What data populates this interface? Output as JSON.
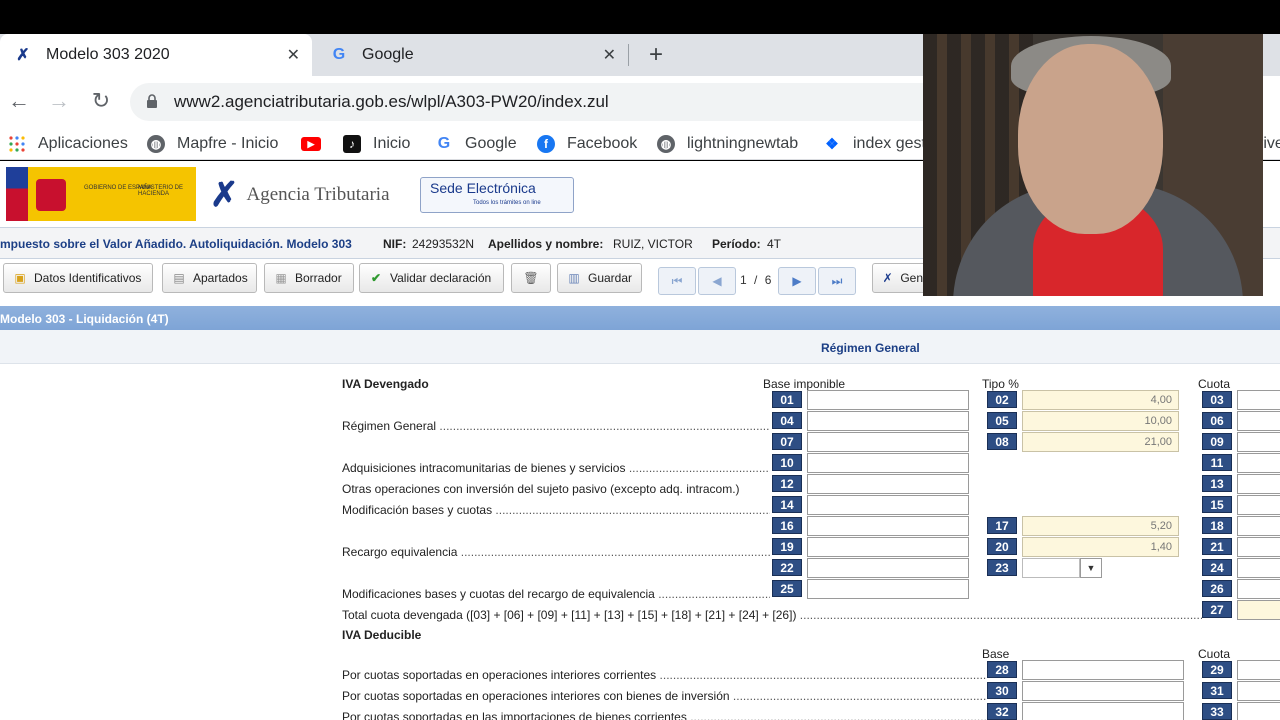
{
  "browser": {
    "tabs": [
      {
        "title": "Modelo 303 2020",
        "favicon": "agencia-tributaria-logo",
        "close": "✕"
      },
      {
        "title": "Google",
        "favicon": "google-logo",
        "close": "✕"
      }
    ],
    "new_tab": "+",
    "url": "www2.agenciatributaria.gob.es/wlpl/A303-PW20/index.zul",
    "bookmarks": [
      {
        "label": "Aplicaciones",
        "icon": "apps-grid-icon"
      },
      {
        "label": "Mapfre - Inicio",
        "icon": "globe-icon"
      },
      {
        "label": "",
        "icon": "youtube-icon"
      },
      {
        "label": "Inicio",
        "icon": "tiktok-like-icon"
      },
      {
        "label": "Google",
        "icon": "google-icon"
      },
      {
        "label": "Facebook",
        "icon": "facebook-icon"
      },
      {
        "label": "lightningnewtab",
        "icon": "globe-icon"
      },
      {
        "label": "index gest",
        "icon": "dropbox-icon"
      },
      {
        "label": "rive",
        "icon": ""
      }
    ]
  },
  "site": {
    "gov_line1": "GOBIERNO DE ESPAÑA",
    "gov_line2": "MINISTERIO DE HACIENDA",
    "agency": "Agencia Tributaria",
    "sede_title": "Sede Electrónica",
    "sede_sub": "Todos los trámites on line"
  },
  "info": {
    "title": "mpuesto sobre el Valor Añadido. Autoliquidación. Modelo 303",
    "nif_label": "NIF:",
    "nif_value": "24293532N",
    "name_label": "Apellidos y nombre:",
    "name_value": "RUIZ, VICTOR",
    "period_label": "Período:",
    "period_value": "4T"
  },
  "toolbar": {
    "datos": "Datos Identificativos",
    "apartados": "Apartados",
    "borrador": "Borrador",
    "validar": "Validar declaración",
    "guardar": "Guardar",
    "page_current": "1",
    "page_sep": "/",
    "page_total": "6",
    "gen": "Gen"
  },
  "section": {
    "title": "Modelo 303 - Liquidación (4T)",
    "regime": "Régimen General"
  },
  "form": {
    "iva_devengado": "IVA Devengado",
    "col_base": "Base imponible",
    "col_tipo": "Tipo %",
    "col_cuota": "Cuota",
    "regimen_general": "Régimen General",
    "adquisiciones": "Adquisiciones intracomunitarias de bienes y servicios",
    "otras_ops": "Otras operaciones con inversión del sujeto pasivo (excepto adq. intracom.)",
    "modificacion": "Modificación bases y cuotas",
    "recargo": "Recargo equivalencia",
    "mod_recargo": "Modificaciones bases y cuotas del recargo de equivalencia",
    "total_devengada": "Total cuota devengada ([03] + [06] + [09] + [11] + [13] + [15] + [18] + [21] + [24] + [26])",
    "iva_deducible": "IVA Deducible",
    "col_base2": "Base",
    "col_cuota2": "Cuota",
    "ded1": "Por cuotas soportadas en operaciones interiores corrientes",
    "ded2": "Por cuotas soportadas en operaciones interiores con bienes de inversión",
    "ded3": "Por cuotas soportadas en las importaciones de bienes corrientes",
    "pct_02": "4,00",
    "pct_05": "10,00",
    "pct_08": "21,00",
    "pct_17": "5,20",
    "pct_20": "1,40",
    "select_23": "",
    "box_01": "01",
    "box_02": "02",
    "box_03": "03",
    "box_04": "04",
    "box_05": "05",
    "box_06": "06",
    "box_07": "07",
    "box_08": "08",
    "box_09": "09",
    "box_10": "10",
    "box_11": "11",
    "box_12": "12",
    "box_13": "13",
    "box_14": "14",
    "box_15": "15",
    "box_16": "16",
    "box_17": "17",
    "box_18": "18",
    "box_19": "19",
    "box_20": "20",
    "box_21": "21",
    "box_22": "22",
    "box_23": "23",
    "box_24": "24",
    "box_25": "25",
    "box_26": "26",
    "box_27": "27",
    "box_28": "28",
    "box_29": "29",
    "box_30": "30",
    "box_31": "31",
    "box_32": "32",
    "box_33": "33"
  }
}
